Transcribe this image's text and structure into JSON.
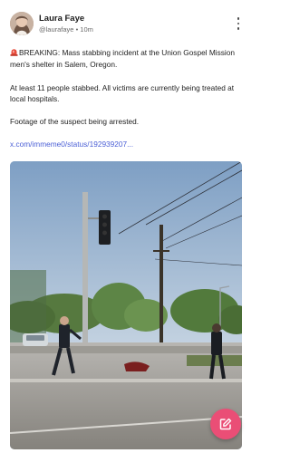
{
  "post": {
    "author_name": "Laura Faye",
    "author_handle": "@laurafaye",
    "separator": "•",
    "time_ago": "10m",
    "breaking_icon": "rotating-light-icon",
    "paragraph1": "BREAKING: Mass stabbing incident at the Union Gospel Mission men's shelter in Salem, Oregon.",
    "paragraph2": "At least 11 people stabbed. All victims are currently being treated at local hospitals.",
    "paragraph3": "Footage of the suspect being arrested.",
    "link_text": "x.com/immeme0/status/192939207..."
  },
  "icons": {
    "menu": "more-vertical-icon",
    "compose": "compose-icon"
  },
  "colors": {
    "link": "#4b5fd6",
    "fab": "#ea4e76"
  }
}
